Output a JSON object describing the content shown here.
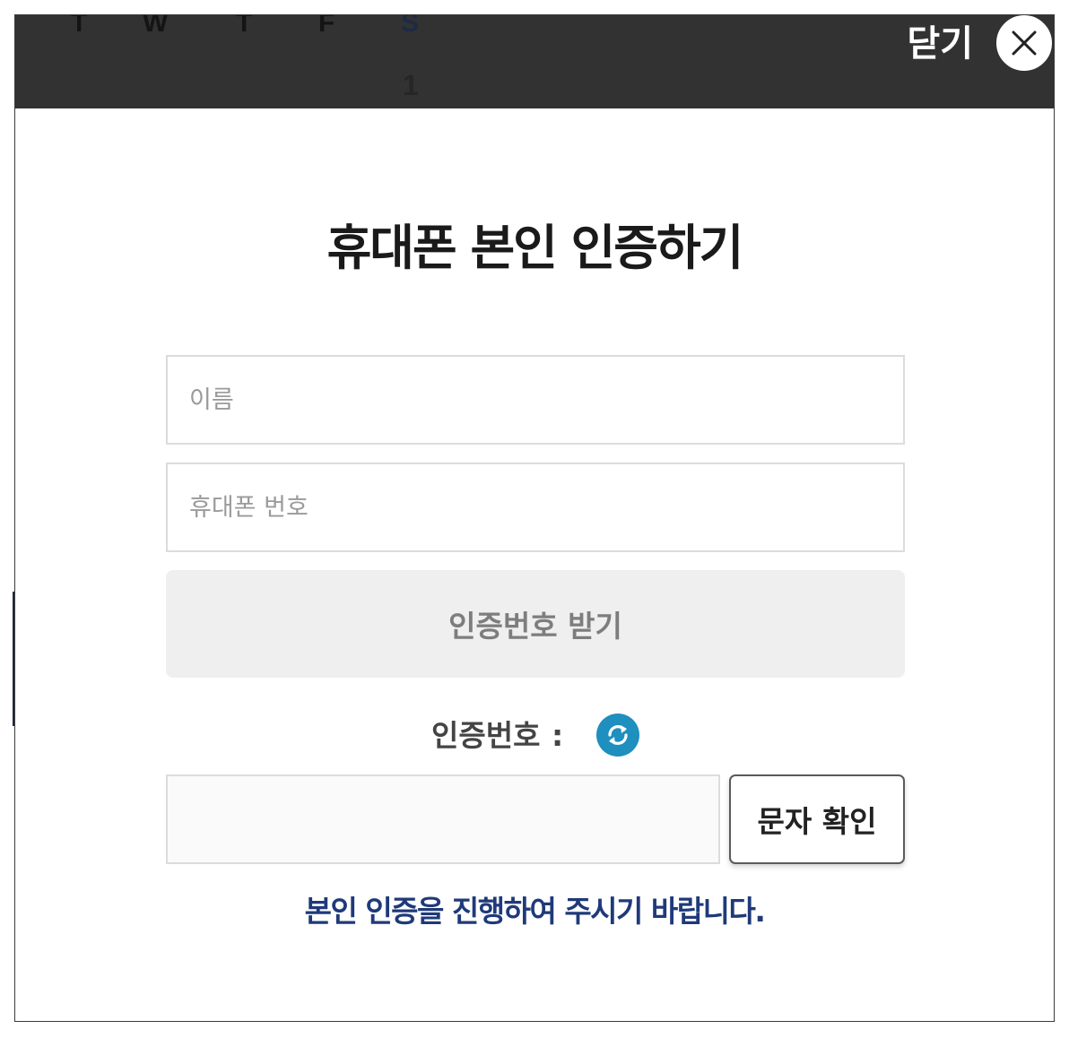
{
  "calendar_header": {
    "weekdays": [
      "T",
      "W",
      "T",
      "F",
      "S"
    ],
    "date": "1"
  },
  "modal": {
    "close_label": "닫기",
    "close_icon": "close-icon",
    "title": "휴대폰 본인 인증하기",
    "name_field": {
      "placeholder": "이름",
      "value": ""
    },
    "phone_field": {
      "placeholder": "휴대폰 번호",
      "value": ""
    },
    "request_button": "인증번호 받기",
    "code_label": "인증번호",
    "code_colon": ":",
    "refresh_icon": "refresh-icon",
    "code_field": {
      "value": ""
    },
    "sms_confirm_button": "문자 확인",
    "notice": "본인 인증을 진행하여 주시기 바랍니다."
  },
  "colors": {
    "header_bg": "#323232",
    "notice_text": "#1f3a7a",
    "refresh_icon_bg": "#1e8fbf",
    "request_button_bg": "#efefef"
  }
}
